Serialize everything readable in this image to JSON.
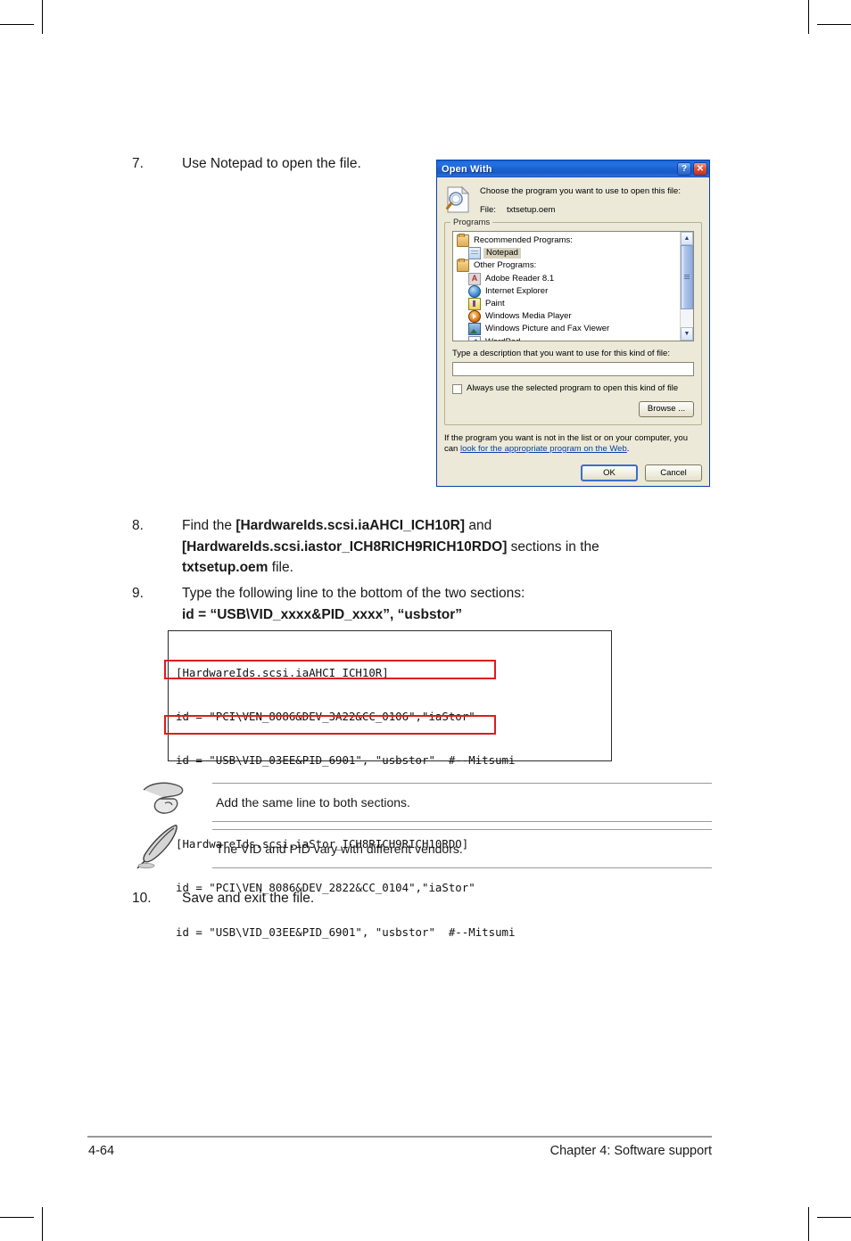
{
  "page": {
    "footer_page_number": "4-64",
    "footer_chapter": "Chapter 4: Software support"
  },
  "steps": {
    "step7": {
      "number": "7.",
      "text": "Use Notepad to open the file."
    },
    "step8": {
      "number": "8.",
      "part1": "Find the ",
      "bold1": "[HardwareIds.scsi.iaAHCI_ICH10R]",
      "part2": " and ",
      "bold2": "[HardwareIds.scsi.iastor_ICH8RICH9RICH10RDO]",
      "part3": " sections in the ",
      "bold3": "txtsetup.oem",
      "part4": " file."
    },
    "step9": {
      "number": "9.",
      "text": "Type the following line to the bottom of the two sections:",
      "bold_line": "id = “USB\\VID_xxxx&PID_xxxx”, “usbstor”"
    },
    "step10": {
      "number": "10.",
      "text": "Save and exit the file."
    }
  },
  "dialog": {
    "title": "Open With",
    "help_button": "?",
    "close_button": "✕",
    "prompt": "Choose the program you want to use to open this file:",
    "file_label": "File:",
    "file_name": "txtsetup.oem",
    "group_legend": "Programs",
    "list": [
      {
        "label": "Recommended Programs:",
        "icon": "folder-icon",
        "indent": false,
        "selected": false,
        "icon_class": "ic-folder"
      },
      {
        "label": "Notepad",
        "icon": "notepad-icon",
        "indent": true,
        "selected": true,
        "icon_class": "ic-notepad"
      },
      {
        "label": "Other Programs:",
        "icon": "folder-icon",
        "indent": false,
        "selected": false,
        "icon_class": "ic-folder"
      },
      {
        "label": "Adobe Reader 8.1",
        "icon": "adobe-reader-icon",
        "indent": true,
        "selected": false,
        "icon_class": "ic-acrobat"
      },
      {
        "label": "Internet Explorer",
        "icon": "internet-explorer-icon",
        "indent": true,
        "selected": false,
        "icon_class": "ic-ie"
      },
      {
        "label": "Paint",
        "icon": "paint-icon",
        "indent": true,
        "selected": false,
        "icon_class": "ic-paint"
      },
      {
        "label": "Windows Media Player",
        "icon": "windows-media-player-icon",
        "indent": true,
        "selected": false,
        "icon_class": "ic-wmp"
      },
      {
        "label": "Windows Picture and Fax Viewer",
        "icon": "picture-fax-viewer-icon",
        "indent": true,
        "selected": false,
        "icon_class": "ic-pictfax"
      },
      {
        "label": "WordPad",
        "icon": "wordpad-icon",
        "indent": true,
        "selected": false,
        "icon_class": "ic-wordpad"
      }
    ],
    "description_label": "Type a description that you want to use for this kind of file:",
    "description_value": "",
    "checkbox_label": "Always use the selected program to open this kind of file",
    "checkbox_checked": false,
    "browse_label": "Browse ...",
    "footnote_text": "If the program you want is not in the list or on your computer, you can ",
    "footnote_link": "look for the appropriate program on the Web",
    "footnote_end": ".",
    "ok_label": "OK",
    "cancel_label": "Cancel",
    "scroll_up": "▲",
    "scroll_down": "▼"
  },
  "code": {
    "line1": "[HardwareIds.scsi.iaAHCI_ICH10R]",
    "line2": "id = \"PCI\\VEN_8086&DEV_3A22&CC_0106\",\"iaStor\"",
    "line3": "id = \"USB\\VID_03EE&PID_6901\", \"usbstor\"  #--Mitsumi",
    "line4": "[HardwareIds.scsi.iaStor_ICH8RICH9RICH10RDO]",
    "line5": "id = \"PCI\\VEN_8086&DEV_2822&CC_0104\",\"iaStor\"",
    "line6": "id = \"USB\\VID_03EE&PID_6901\", \"usbstor\"  #--Mitsumi",
    "highlight_color": "#e01b1b"
  },
  "notes": {
    "note1": {
      "icon": "pointing-hand-icon",
      "text": "Add the same line to both sections."
    },
    "note2": {
      "icon": "quill-pen-icon",
      "text": "The VID and PID vary with different vendors."
    }
  }
}
